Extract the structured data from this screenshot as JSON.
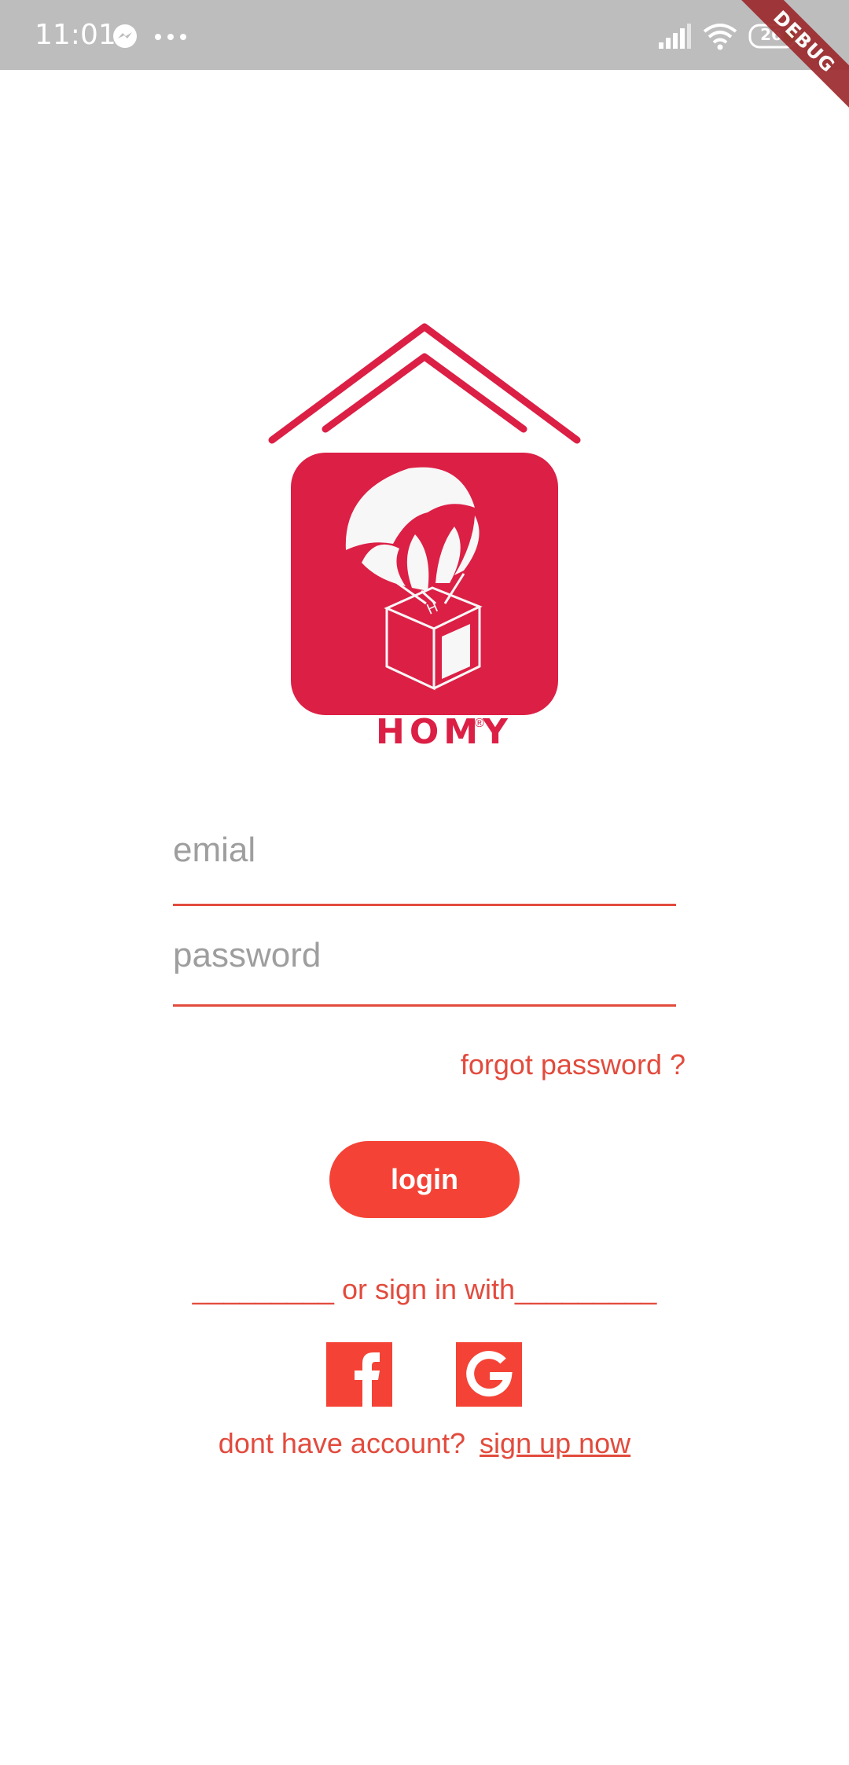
{
  "status_bar": {
    "time": "11:01",
    "battery_level": "26"
  },
  "debug_banner": "DEBUG",
  "logo": {
    "brand_name": "HOMY",
    "registered_mark": "®",
    "box_mark": "H",
    "brand_color": "#dc1f45"
  },
  "form": {
    "email_placeholder": "emial",
    "password_placeholder": "password",
    "forgot_password": "forgot password ?",
    "login_label": "login"
  },
  "social": {
    "divider_left": "_________",
    "divider_text": " or sign in with",
    "divider_right": "_________",
    "facebook_icon": "facebook-icon",
    "google_icon": "google-icon"
  },
  "signup": {
    "prompt": "dont have account?",
    "link": "sign up now"
  },
  "colors": {
    "accent": "#f44336",
    "text_accent": "#e24b3d",
    "placeholder": "#9e9e9e",
    "status_bar": "#bdbdbd"
  }
}
